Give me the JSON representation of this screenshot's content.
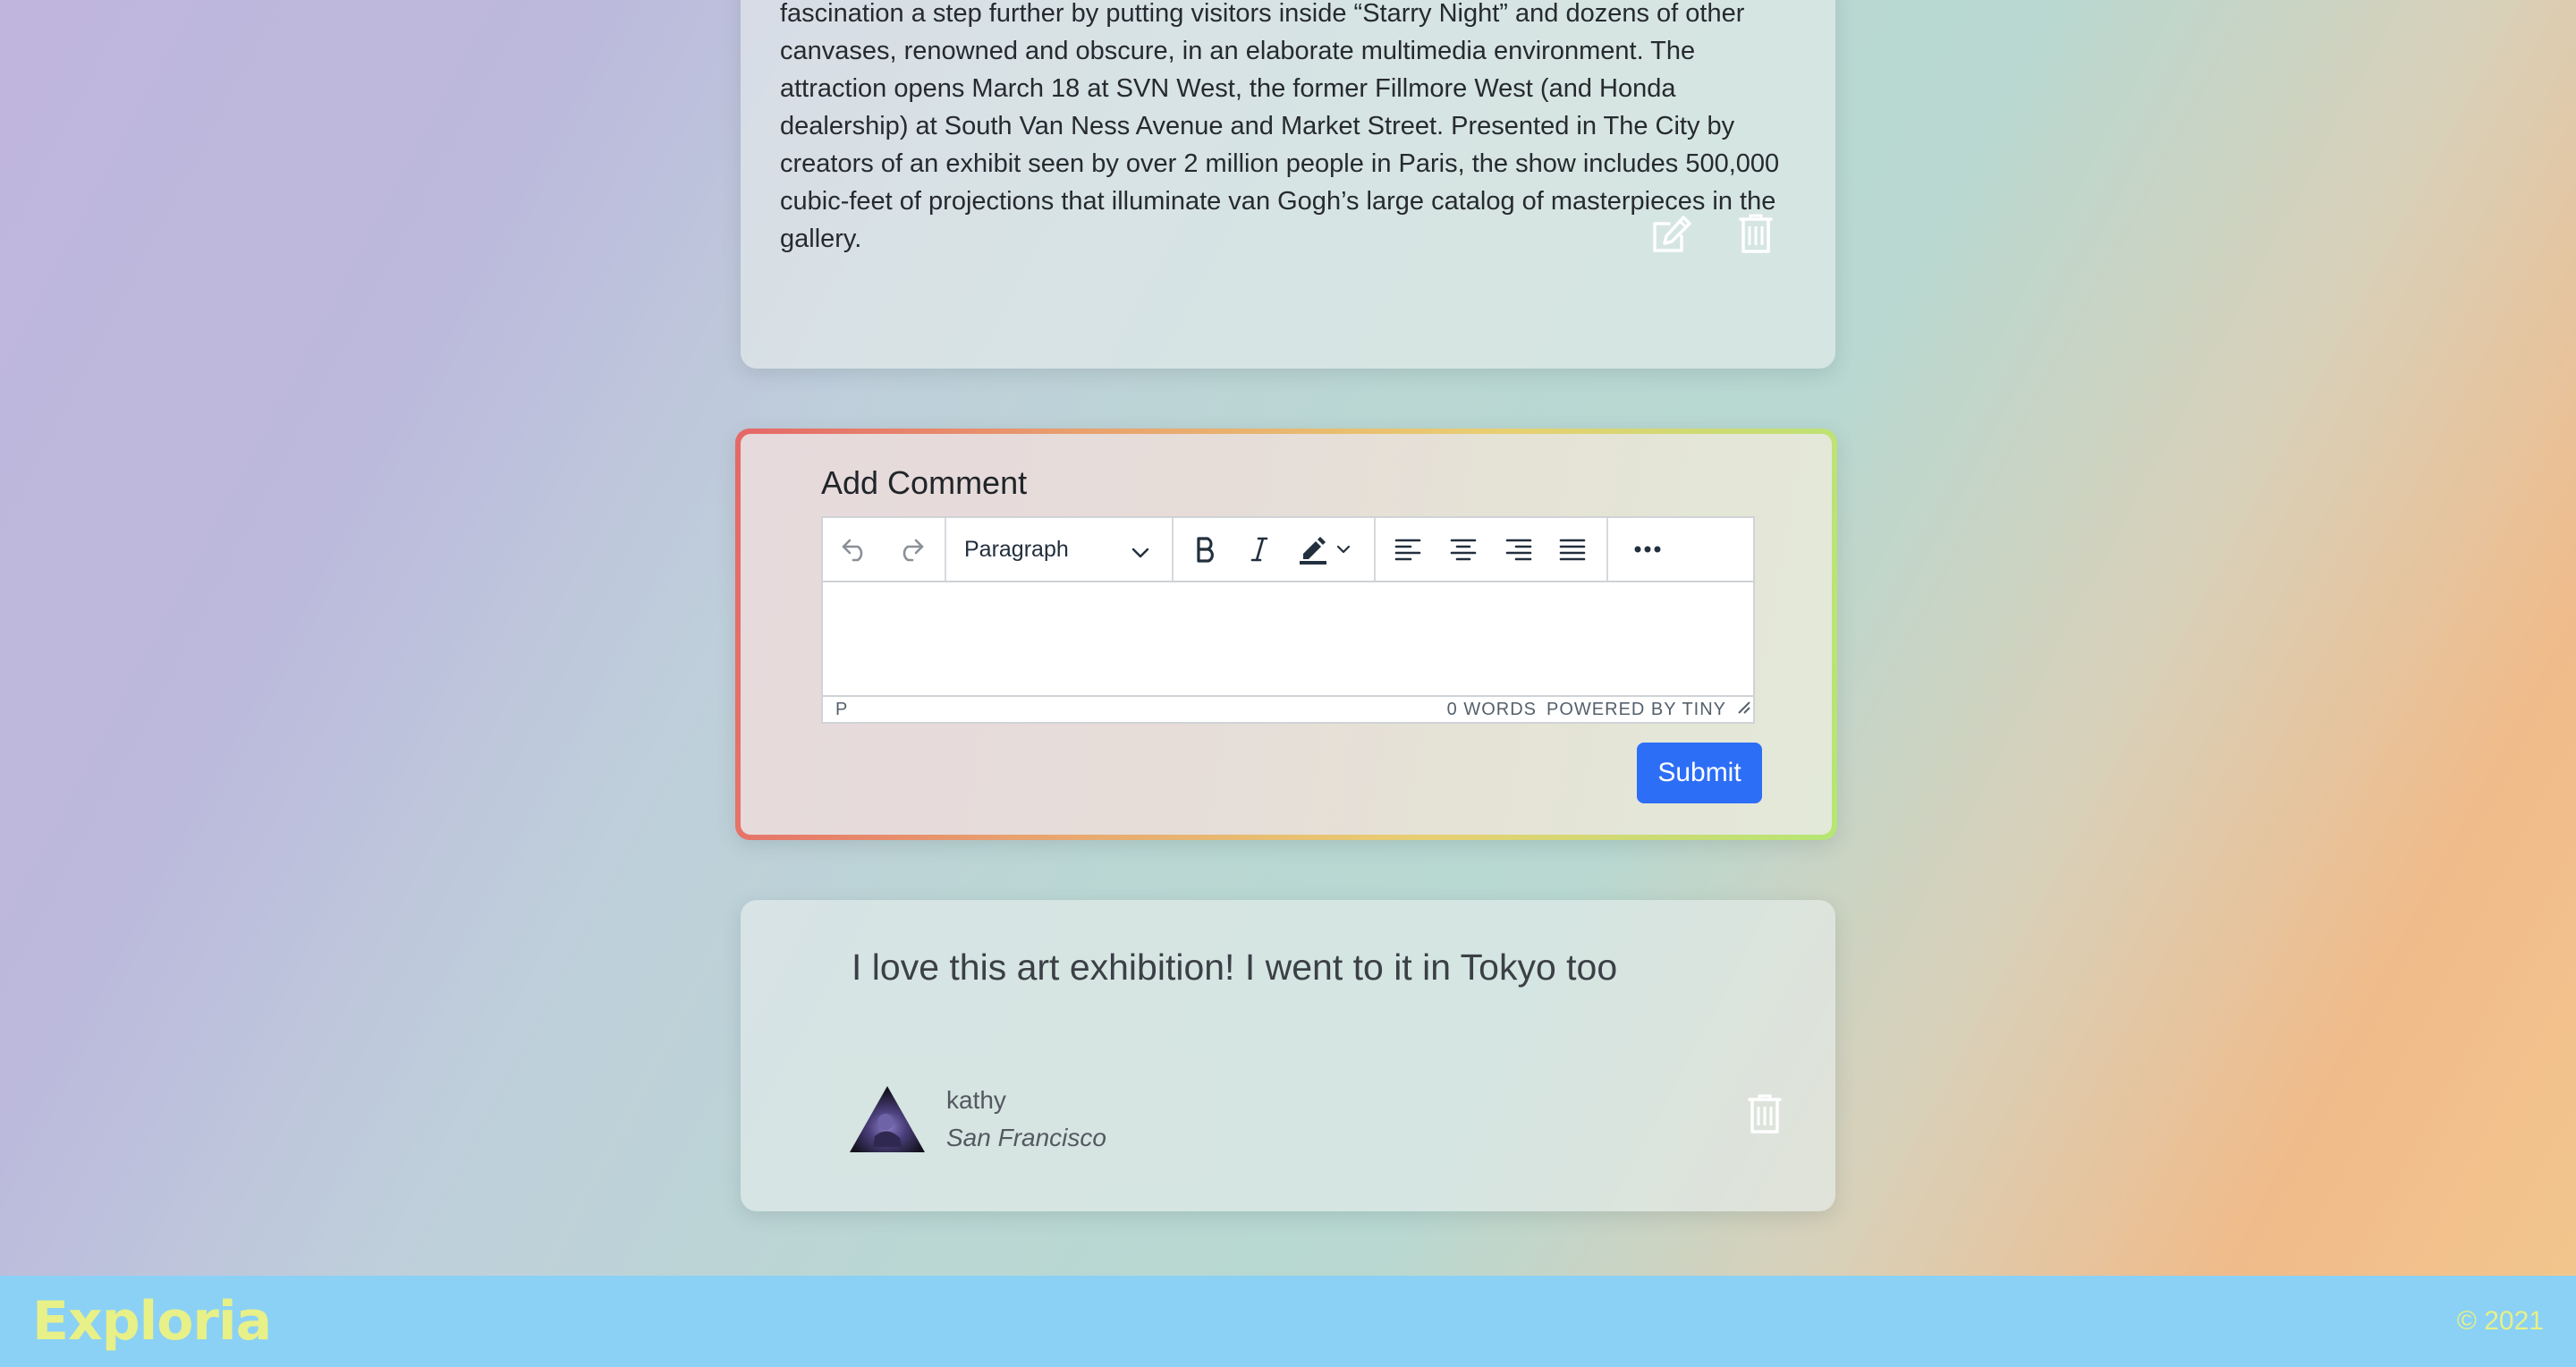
{
  "post": {
    "text": "fascination a step further by putting visitors inside “Starry Night” and dozens of other canvases, renowned and obscure, in an elaborate multimedia environment. The attraction opens March 18 at SVN West, the former Fillmore West (and Honda dealership) at South Van Ness Avenue and Market Street. Presented in The City by creators of an exhibit seen by over 2 million people in Paris, the show includes 500,000 cubic-feet of projections that illuminate van Gogh’s large catalog of masterpieces in the gallery.",
    "edit_icon": "edit-icon",
    "delete_icon": "trash-icon"
  },
  "comment_form": {
    "title": "Add Comment",
    "toolbar": {
      "block_format": "Paragraph",
      "icons": [
        "undo-icon",
        "redo-icon",
        "bold-icon",
        "italic-icon",
        "highlight-icon",
        "align-left-icon",
        "align-center-icon",
        "align-right-icon",
        "justify-icon",
        "more-icon"
      ]
    },
    "status": {
      "path": "P",
      "words": "0 WORDS",
      "brand": "POWERED BY TINY"
    },
    "submit_label": "Submit",
    "colors": {
      "accent": "#2d6ef7",
      "border_start": "#e56767",
      "border_end": "#b5e674"
    }
  },
  "comment": {
    "text": "I love this art exhibition! I went to it in Tokyo too",
    "author": {
      "name": "kathy",
      "city": "San Francisco"
    },
    "delete_icon": "trash-icon"
  },
  "footer": {
    "logo": "Exploria",
    "copyright": "© 2021",
    "colors": {
      "background": "#8ad1f5",
      "text": "#e8f088"
    }
  }
}
